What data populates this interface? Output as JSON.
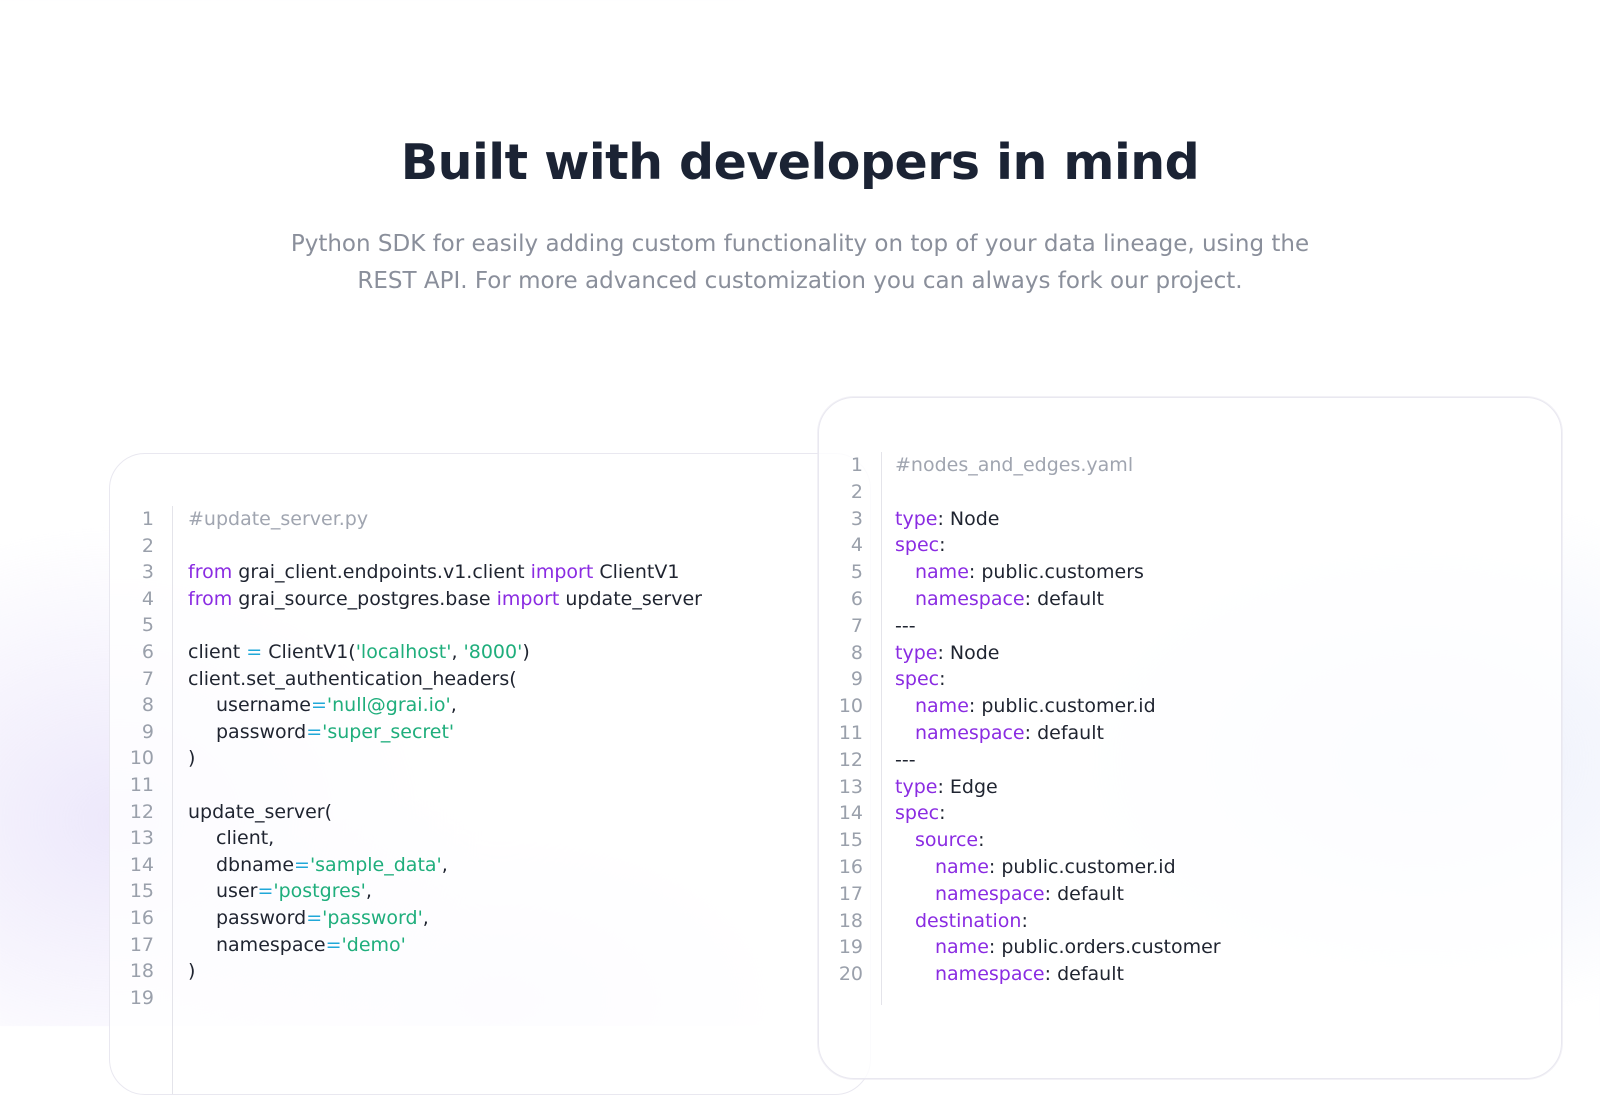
{
  "header": {
    "title": "Built with developers in mind",
    "subtitle_line1": "Python SDK for easily adding custom functionality on top of your data lineage, using the",
    "subtitle_line2": "REST API. For more advanced customization you can always fork our project."
  },
  "python_code": {
    "lines": [
      {
        "n": "1",
        "indent": 0,
        "tokens": [
          {
            "t": "#update_server.py",
            "c": "cm"
          }
        ]
      },
      {
        "n": "2",
        "indent": 0,
        "tokens": []
      },
      {
        "n": "3",
        "indent": 0,
        "tokens": [
          {
            "t": "from",
            "c": "kw"
          },
          {
            "t": " grai_client.endpoints.v1.client ",
            "c": ""
          },
          {
            "t": "import",
            "c": "kw"
          },
          {
            "t": " ClientV1",
            "c": ""
          }
        ]
      },
      {
        "n": "4",
        "indent": 0,
        "tokens": [
          {
            "t": "from",
            "c": "kw"
          },
          {
            "t": " grai_source_postgres.base ",
            "c": ""
          },
          {
            "t": "import",
            "c": "kw"
          },
          {
            "t": " update_server",
            "c": ""
          }
        ]
      },
      {
        "n": "5",
        "indent": 0,
        "tokens": []
      },
      {
        "n": "6",
        "indent": 0,
        "tokens": [
          {
            "t": "client ",
            "c": ""
          },
          {
            "t": "=",
            "c": "op"
          },
          {
            "t": " ClientV1(",
            "c": ""
          },
          {
            "t": "'localhost'",
            "c": "str"
          },
          {
            "t": ", ",
            "c": ""
          },
          {
            "t": "'8000'",
            "c": "str"
          },
          {
            "t": ")",
            "c": ""
          }
        ]
      },
      {
        "n": "7",
        "indent": 0,
        "tokens": [
          {
            "t": "client.set_authentication_headers(",
            "c": ""
          }
        ]
      },
      {
        "n": "8",
        "indent": 1,
        "tokens": [
          {
            "t": "username",
            "c": ""
          },
          {
            "t": "=",
            "c": "op"
          },
          {
            "t": "'null@grai.io'",
            "c": "str"
          },
          {
            "t": ",",
            "c": ""
          }
        ]
      },
      {
        "n": "9",
        "indent": 1,
        "tokens": [
          {
            "t": "password",
            "c": ""
          },
          {
            "t": "=",
            "c": "op"
          },
          {
            "t": "'super_secret'",
            "c": "str"
          }
        ]
      },
      {
        "n": "10",
        "indent": 0,
        "tokens": [
          {
            "t": ")",
            "c": ""
          }
        ]
      },
      {
        "n": "11",
        "indent": 0,
        "tokens": []
      },
      {
        "n": "12",
        "indent": 0,
        "tokens": [
          {
            "t": "update_server(",
            "c": ""
          }
        ]
      },
      {
        "n": "13",
        "indent": 1,
        "tokens": [
          {
            "t": "client,",
            "c": ""
          }
        ]
      },
      {
        "n": "14",
        "indent": 1,
        "tokens": [
          {
            "t": "dbname",
            "c": ""
          },
          {
            "t": "=",
            "c": "op"
          },
          {
            "t": "'sample_data'",
            "c": "str"
          },
          {
            "t": ",",
            "c": ""
          }
        ]
      },
      {
        "n": "15",
        "indent": 1,
        "tokens": [
          {
            "t": "user",
            "c": ""
          },
          {
            "t": "=",
            "c": "op"
          },
          {
            "t": "'postgres'",
            "c": "str"
          },
          {
            "t": ",",
            "c": ""
          }
        ]
      },
      {
        "n": "16",
        "indent": 1,
        "tokens": [
          {
            "t": "password",
            "c": ""
          },
          {
            "t": "=",
            "c": "op"
          },
          {
            "t": "'password'",
            "c": "str"
          },
          {
            "t": ",",
            "c": ""
          }
        ]
      },
      {
        "n": "17",
        "indent": 1,
        "tokens": [
          {
            "t": "namespace",
            "c": ""
          },
          {
            "t": "=",
            "c": "op"
          },
          {
            "t": "'demo'",
            "c": "str"
          }
        ]
      },
      {
        "n": "18",
        "indent": 0,
        "tokens": [
          {
            "t": ")",
            "c": ""
          }
        ]
      },
      {
        "n": "19",
        "indent": 0,
        "tokens": []
      }
    ]
  },
  "yaml_code": {
    "lines": [
      {
        "n": "1",
        "indent": 0,
        "tokens": [
          {
            "t": "#nodes_and_edges.yaml",
            "c": "cm"
          }
        ]
      },
      {
        "n": "2",
        "indent": 0,
        "tokens": []
      },
      {
        "n": "3",
        "indent": 0,
        "tokens": [
          {
            "t": "type",
            "c": "kw"
          },
          {
            "t": ": Node",
            "c": ""
          }
        ]
      },
      {
        "n": "4",
        "indent": 0,
        "tokens": [
          {
            "t": "spec",
            "c": "kw"
          },
          {
            "t": ":",
            "c": ""
          }
        ]
      },
      {
        "n": "5",
        "indent": 1,
        "tokens": [
          {
            "t": "name",
            "c": "kw"
          },
          {
            "t": ": public.customers",
            "c": ""
          }
        ]
      },
      {
        "n": "6",
        "indent": 1,
        "tokens": [
          {
            "t": "namespace",
            "c": "kw"
          },
          {
            "t": ": default",
            "c": ""
          }
        ]
      },
      {
        "n": "7",
        "indent": 0,
        "tokens": [
          {
            "t": "---",
            "c": ""
          }
        ]
      },
      {
        "n": "8",
        "indent": 0,
        "tokens": [
          {
            "t": "type",
            "c": "kw"
          },
          {
            "t": ": Node",
            "c": ""
          }
        ]
      },
      {
        "n": "9",
        "indent": 0,
        "tokens": [
          {
            "t": "spec",
            "c": "kw"
          },
          {
            "t": ":",
            "c": ""
          }
        ]
      },
      {
        "n": "10",
        "indent": 1,
        "tokens": [
          {
            "t": "name",
            "c": "kw"
          },
          {
            "t": ": public.customer.id",
            "c": ""
          }
        ]
      },
      {
        "n": "11",
        "indent": 1,
        "tokens": [
          {
            "t": "namespace",
            "c": "kw"
          },
          {
            "t": ": default",
            "c": ""
          }
        ]
      },
      {
        "n": "12",
        "indent": 0,
        "tokens": [
          {
            "t": "---",
            "c": ""
          }
        ]
      },
      {
        "n": "13",
        "indent": 0,
        "tokens": [
          {
            "t": "type",
            "c": "kw"
          },
          {
            "t": ": Edge",
            "c": ""
          }
        ]
      },
      {
        "n": "14",
        "indent": 0,
        "tokens": [
          {
            "t": "spec",
            "c": "kw"
          },
          {
            "t": ":",
            "c": ""
          }
        ]
      },
      {
        "n": "15",
        "indent": 1,
        "tokens": [
          {
            "t": "source",
            "c": "kw"
          },
          {
            "t": ":",
            "c": ""
          }
        ]
      },
      {
        "n": "16",
        "indent": 2,
        "tokens": [
          {
            "t": "name",
            "c": "kw"
          },
          {
            "t": ": public.customer.id",
            "c": ""
          }
        ]
      },
      {
        "n": "17",
        "indent": 2,
        "tokens": [
          {
            "t": "namespace",
            "c": "kw"
          },
          {
            "t": ": default",
            "c": ""
          }
        ]
      },
      {
        "n": "18",
        "indent": 1,
        "tokens": [
          {
            "t": "destination",
            "c": "kw"
          },
          {
            "t": ":",
            "c": ""
          }
        ]
      },
      {
        "n": "19",
        "indent": 2,
        "tokens": [
          {
            "t": "name",
            "c": "kw"
          },
          {
            "t": ": public.orders.customer",
            "c": ""
          }
        ]
      },
      {
        "n": "20",
        "indent": 2,
        "tokens": [
          {
            "t": "namespace",
            "c": "kw"
          },
          {
            "t": ": default",
            "c": ""
          }
        ]
      }
    ]
  }
}
